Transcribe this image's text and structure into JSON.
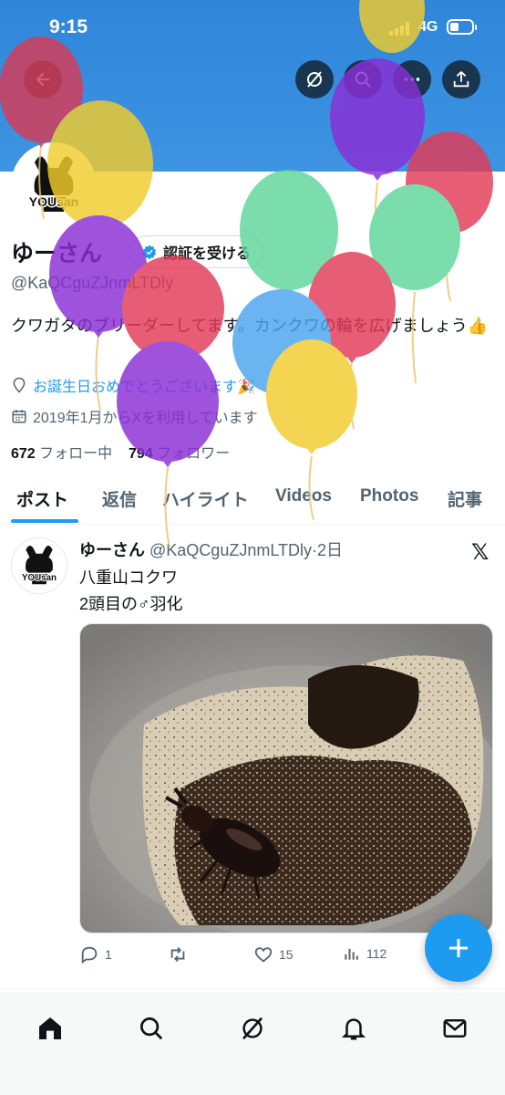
{
  "status_bar": {
    "time": "9:15",
    "network": "4G"
  },
  "profile": {
    "avatar_text": "YOUsan",
    "name": "ゆーさん",
    "handle": "@KaQCguZJnmLTDly",
    "verify_label": "認証を受ける",
    "bio": "クワガタのブリーダーしてます。カンクワの輪を広げましょう👍",
    "birthday": "お誕生日おめでとうございます🎉",
    "joined": "2019年1月からXを利用しています",
    "following_count": "672",
    "following_label": "フォロー中",
    "followers_count": "794",
    "followers_label": "フォロワー"
  },
  "tabs": [
    "ポスト",
    "返信",
    "ハイライト",
    "Videos",
    "Photos",
    "記事"
  ],
  "post": {
    "avatar_text": "YOUsan",
    "author": "ゆーさん",
    "handle": "@KaQCguZJnmLTDly",
    "time": "·2日",
    "source_icon": "𝕏",
    "line1": "八重山コクワ",
    "line2": "2頭目の♂羽化",
    "replies": "1",
    "likes": "15",
    "views": "112"
  },
  "colors": {
    "accent": "#1d9bf0",
    "banner": "#3a90df"
  },
  "icons": [
    "back-arrow-icon",
    "grok-icon",
    "search-icon",
    "share-icon",
    "verified-badge-icon",
    "location-pin-icon",
    "calendar-icon",
    "reply-icon",
    "retweet-icon",
    "like-icon",
    "views-icon",
    "compose-icon",
    "home-icon",
    "explore-icon",
    "grok-nav-icon",
    "notifications-icon",
    "messages-icon"
  ]
}
